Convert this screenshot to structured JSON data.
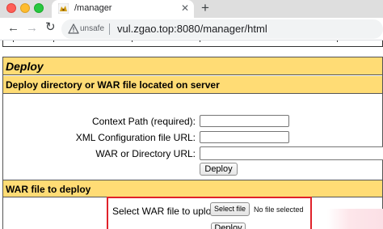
{
  "browser": {
    "tab_title": "/manager",
    "tab_close_icon": "close-icon",
    "new_tab_icon": "plus-icon",
    "security_label": "unsafe",
    "url": "vul.zgao.top:8080/manager/html",
    "traffic_light_colors": [
      "#ff5f57",
      "#febc2e",
      "#28c840"
    ]
  },
  "deploy": {
    "title": "Deploy",
    "server_section": {
      "header": "Deploy directory or WAR file located on server",
      "context_path_label": "Context Path (required):",
      "context_path_value": "",
      "xml_config_label": "XML Configuration file URL:",
      "xml_config_value": "",
      "war_dir_label": "WAR or Directory URL:",
      "war_dir_value": "",
      "deploy_button": "Deploy"
    },
    "upload_section": {
      "header": "WAR file to deploy",
      "select_label": "Select WAR file to upload",
      "select_button": "Select file",
      "file_status": "No file selected",
      "deploy_button": "Deploy",
      "highlight_color": "#e0222a"
    },
    "header_color": "#ffdc75"
  }
}
